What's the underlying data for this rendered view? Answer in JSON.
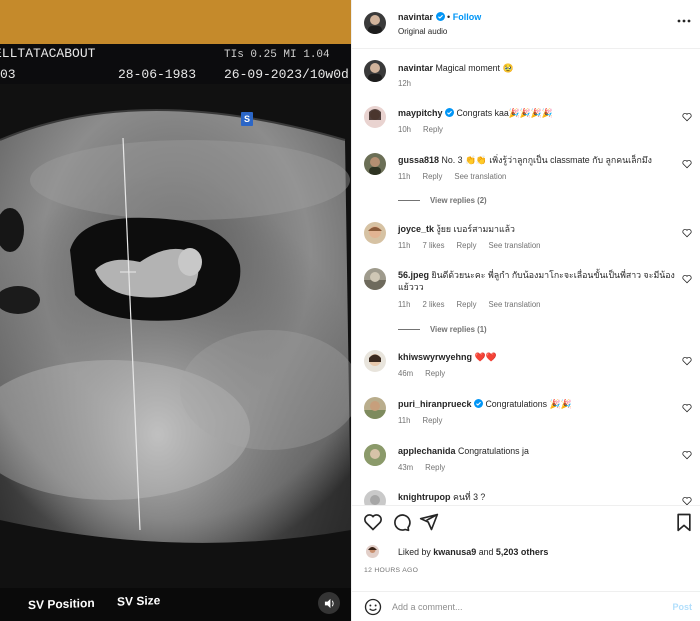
{
  "media": {
    "scan_label_left": "ELLTATACABOUT",
    "scan_id_fragment": "03",
    "birth_date": "28-06-1983",
    "ti_label": "TIs 0.25  MI 1.04",
    "exam_date": "26-09-2023/10w0d",
    "marker": "S",
    "sv_position": "SV Position",
    "sv_size": "SV Size"
  },
  "post": {
    "author": "navintar",
    "follow_label": "Follow",
    "audio": "Original audio",
    "caption": "Magical moment 🥹",
    "caption_time": "12h"
  },
  "comments": [
    {
      "user": "maypitchy",
      "verified": true,
      "text": "Congrats kaa🎉🎉🎉🎉",
      "time": "10h",
      "likes": "",
      "reply": "Reply",
      "translate": ""
    },
    {
      "user": "gussa818",
      "verified": false,
      "text": "No. 3 👏👏 เพิ่งรู้ว่าลูกกูเป็น classmate กับ ลูกคนเล็กมึง",
      "time": "11h",
      "likes": "",
      "reply": "Reply",
      "translate": "See translation",
      "view_replies": "View replies (2)"
    },
    {
      "user": "joyce_tk",
      "verified": false,
      "text": "งู้ยย เบอร์สามมาแล้ว",
      "time": "11h",
      "likes": "7 likes",
      "reply": "Reply",
      "translate": "See translation"
    },
    {
      "user": "56.jpeg",
      "verified": false,
      "text": "ยินดีด้วยนะคะ พี่ลูกำ กับน้องมาโกะจะเลื่อนขั้นเป็นพี่สาว จะมีน้องแย้ววว",
      "time": "11h",
      "likes": "2 likes",
      "reply": "Reply",
      "translate": "See translation",
      "view_replies": "View replies (1)"
    },
    {
      "user": "khiwswyrwyehng",
      "verified": false,
      "text": "❤️❤️",
      "time": "46m",
      "likes": "",
      "reply": "Reply",
      "translate": ""
    },
    {
      "user": "puri_hiranprueck",
      "verified": true,
      "text": "Congratulations 🎉🎉",
      "time": "11h",
      "likes": "",
      "reply": "Reply",
      "translate": ""
    },
    {
      "user": "applechanida",
      "verified": false,
      "text": "Congratulations ja",
      "time": "43m",
      "likes": "",
      "reply": "Reply",
      "translate": ""
    },
    {
      "user": "knightrupop",
      "verified": false,
      "text": "คนที่ 3 ?",
      "time": "",
      "likes": "",
      "reply": "",
      "translate": ""
    }
  ],
  "likes": {
    "liked_by_prefix": "Liked by",
    "liked_by_user": "kwanusa9",
    "and": "and",
    "count": "5,203 others"
  },
  "time_ago": "12 HOURS AGO",
  "composer": {
    "placeholder": "Add a comment...",
    "post_label": "Post"
  },
  "colors": {
    "accent": "#0095f6",
    "post_disabled": "#b2dffc",
    "heart": "#ed4956"
  },
  "icons": [
    "verified-icon",
    "heart-icon",
    "comment-icon",
    "share-icon",
    "bookmark-icon",
    "emoji-icon",
    "audio-icon",
    "more-icon"
  ]
}
